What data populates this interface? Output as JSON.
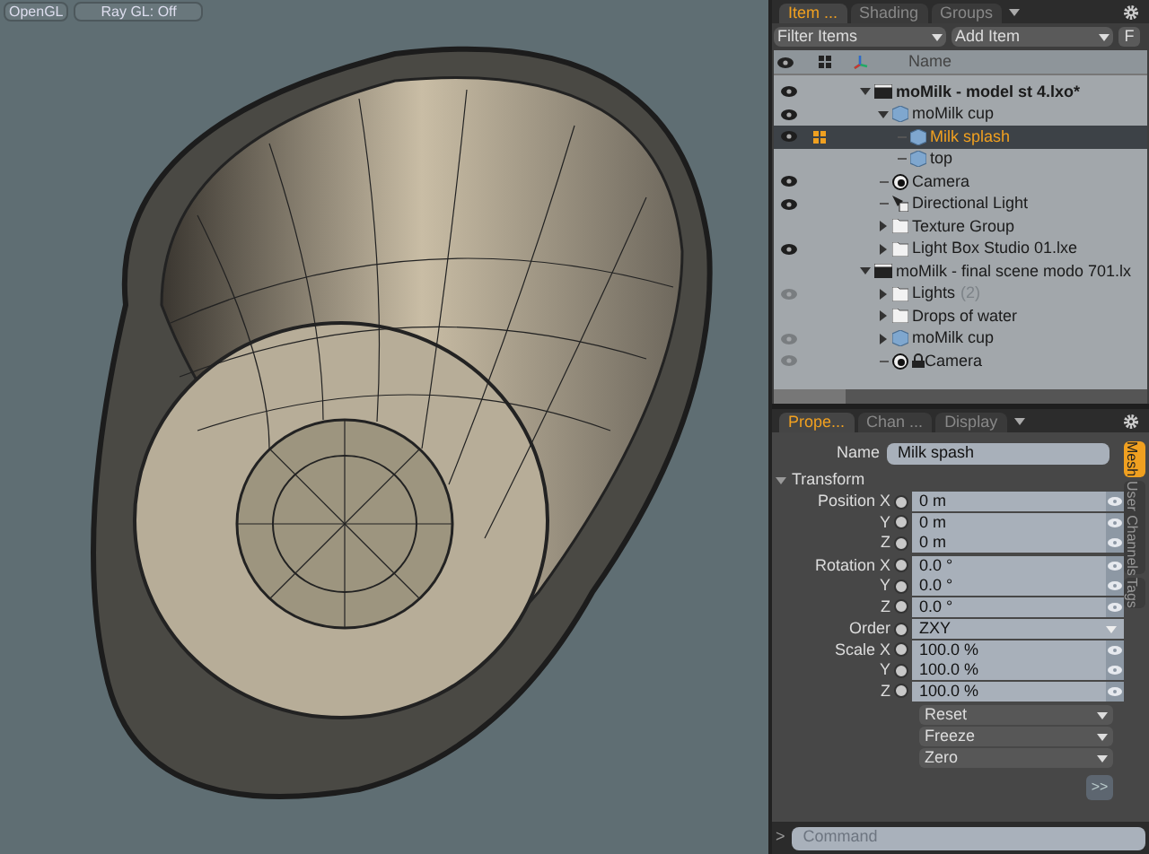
{
  "viewport_toolbar": {
    "buttons": [
      {
        "label": "OpenGL"
      },
      {
        "label": "Ray GL: Off"
      }
    ]
  },
  "items_panel": {
    "tabs": [
      {
        "label": "Item ...",
        "selected": true
      },
      {
        "label": "Shading",
        "selected": false
      },
      {
        "label": "Groups",
        "selected": false
      }
    ],
    "filter": {
      "label": "Filter Items"
    },
    "add_item": {
      "label": "Add Item"
    },
    "f_button": "F",
    "column_name": "Name",
    "tree": [
      {
        "kind": "scene",
        "label": "moMilk - model st 4.lxo*",
        "visible": true,
        "dimmed": false,
        "selected": false,
        "expanded": true,
        "children": [
          {
            "kind": "mesh",
            "label": "moMilk cup",
            "visible": true,
            "dimmed": false,
            "selected": false,
            "expanded": true,
            "children": [
              {
                "kind": "mesh",
                "label": "Milk splash",
                "visible": true,
                "dimmed": false,
                "selected": true
              },
              {
                "kind": "mesh",
                "label": "top",
                "visible": false,
                "selected": false
              }
            ]
          },
          {
            "kind": "camera",
            "label": "Camera",
            "visible": true,
            "dimmed": false,
            "selected": false
          },
          {
            "kind": "light",
            "label": "Directional Light",
            "visible": true,
            "dimmed": false,
            "selected": false
          },
          {
            "kind": "group",
            "label": "Texture Group",
            "visible": false,
            "selected": false,
            "expanded": false
          },
          {
            "kind": "group",
            "label": "Light Box Studio 01.lxe",
            "visible": true,
            "dimmed": false,
            "selected": false,
            "expanded": false
          }
        ]
      },
      {
        "kind": "scene",
        "label": "moMilk - final scene modo 701.lx",
        "visible": false,
        "selected": false,
        "expanded": true,
        "children": [
          {
            "kind": "group",
            "label": "Lights",
            "count": "(2)",
            "visible": true,
            "dimmed": true,
            "selected": false,
            "expanded": false
          },
          {
            "kind": "group",
            "label": "Drops of water",
            "visible": false,
            "selected": false,
            "expanded": false
          },
          {
            "kind": "mesh",
            "label": "moMilk cup",
            "visible": true,
            "dimmed": true,
            "selected": false,
            "expanded": false
          },
          {
            "kind": "camera",
            "label": "Camera",
            "visible": true,
            "dimmed": true,
            "selected": false,
            "locked": true
          }
        ]
      }
    ]
  },
  "properties_panel": {
    "tabs": [
      {
        "label": "Prope...",
        "selected": true
      },
      {
        "label": "Chan ...",
        "selected": false
      },
      {
        "label": "Display",
        "selected": false
      }
    ],
    "name_label": "Name",
    "name_value": "Milk spash",
    "section": "Transform",
    "rows": [
      {
        "kind": "value",
        "label": "Position X",
        "value": "0 m"
      },
      {
        "kind": "value",
        "label": "Y",
        "value": "0 m"
      },
      {
        "kind": "value",
        "label": "Z",
        "value": "0 m"
      },
      {
        "kind": "value",
        "label": "Rotation X",
        "value": "0.0 °"
      },
      {
        "kind": "value",
        "label": "Y",
        "value": "0.0 °"
      },
      {
        "kind": "value",
        "label": "Z",
        "value": "0.0 °"
      },
      {
        "kind": "dropdown",
        "label": "Order",
        "value": "ZXY"
      },
      {
        "kind": "value",
        "label": "Scale X",
        "value": "100.0 %"
      },
      {
        "kind": "value",
        "label": "Y",
        "value": "100.0 %"
      },
      {
        "kind": "value",
        "label": "Z",
        "value": "100.0 %"
      }
    ],
    "actions": [
      "Reset",
      "Freeze",
      "Zero"
    ],
    "more_button": ">>",
    "side_tabs": [
      {
        "label": "Mesh",
        "selected": true
      },
      {
        "label": "User Channels",
        "selected": false
      },
      {
        "label": "Tags",
        "selected": false
      }
    ]
  },
  "command_bar": {
    "prompt": ">",
    "placeholder": "Command"
  }
}
